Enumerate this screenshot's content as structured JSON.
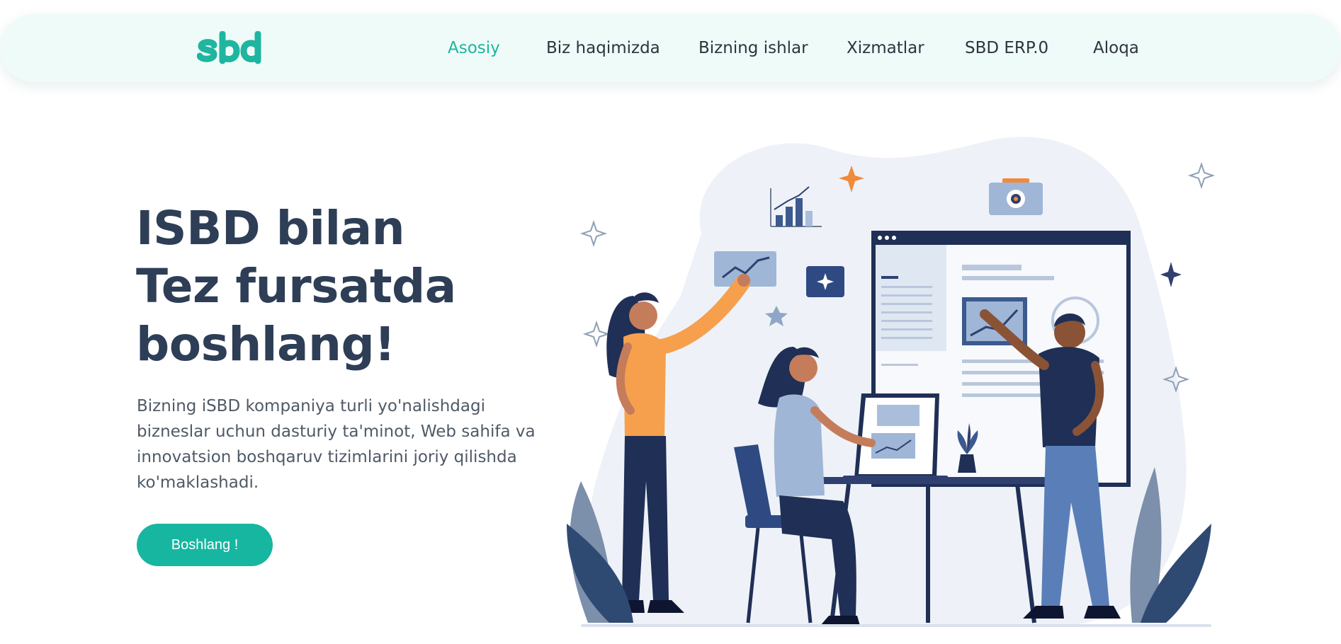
{
  "header": {
    "logo_text": "sbd",
    "nav": [
      {
        "label": "Asosiy",
        "active": true
      },
      {
        "label": "Biz haqimizda",
        "active": false
      },
      {
        "label": "Bizning ishlar",
        "active": false
      },
      {
        "label": "Xizmatlar",
        "active": false
      },
      {
        "label": "SBD ERP.0",
        "active": false
      },
      {
        "label": "Aloqa",
        "active": false
      }
    ]
  },
  "hero": {
    "title_lines": [
      "ISBD bilan",
      "Tez fursatda",
      "boshlang!"
    ],
    "description": "Bizning iSBD kompaniya turli yo'nalishdagi bizneslar uchun dasturiy ta'minot, Web sahifa va innovatsion boshqaruv tizimlarini joriy qilishda ko'maklashadi.",
    "cta_label": "Boshlang !"
  },
  "colors": {
    "accent": "#17b6a1",
    "nav_bg": "#effbf8",
    "heading": "#2d3e56",
    "text": "#4f5a66",
    "illustration_orange": "#f6a04d",
    "illustration_navy": "#1f2f55",
    "illustration_blue": "#5a7fb8"
  },
  "illustration": {
    "semantic": "team-working-illustration"
  }
}
